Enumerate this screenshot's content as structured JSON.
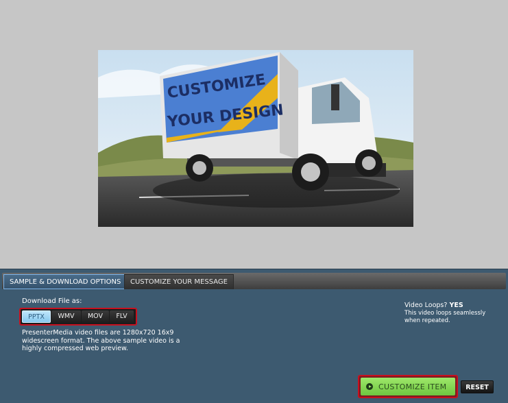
{
  "preview": {
    "truck_sign_line1": "CUSTOMIZE",
    "truck_sign_line2": "YOUR DESIGN"
  },
  "tabs": [
    {
      "label": "SAMPLE & DOWNLOAD OPTIONS",
      "active": true
    },
    {
      "label": "CUSTOMIZE YOUR MESSAGE",
      "active": false
    }
  ],
  "download": {
    "label": "Download File as:",
    "formats": [
      "PPTX",
      "WMV",
      "MOV",
      "FLV"
    ],
    "selected": "PPTX",
    "description": "PresenterMedia video files are 1280x720 16x9 widescreen format. The above sample video is a highly compressed web preview."
  },
  "loops": {
    "title": "Video Loops?",
    "value": "YES",
    "description": "This video loops seamlessly when repeated."
  },
  "actions": {
    "customize_label": "CUSTOMIZE ITEM",
    "reset_label": "RESET"
  },
  "colors": {
    "panel_bg": "#3d5a70",
    "accent_red": "#c8101e",
    "customize_green": "#86d456",
    "active_format": "#a8dbf7"
  }
}
